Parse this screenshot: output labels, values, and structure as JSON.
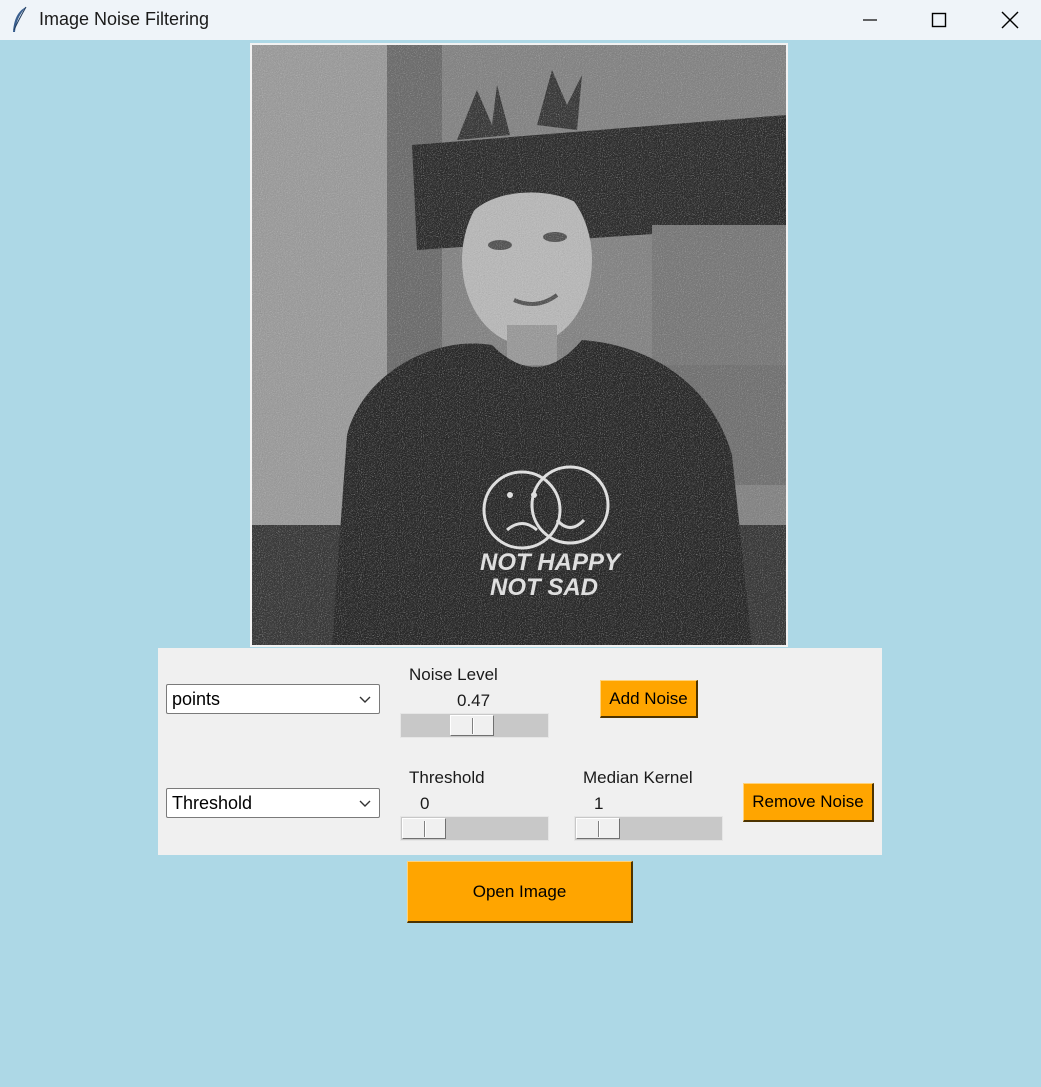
{
  "window": {
    "title": "Image Noise Filtering",
    "icon": "feather-icon",
    "controls": [
      "minimize-icon",
      "maximize-icon",
      "close-icon"
    ]
  },
  "noise_controls": {
    "noise_type": {
      "selected": "points"
    },
    "noise_level": {
      "label": "Noise Level",
      "value": "0.47"
    },
    "add_button": "Add Noise"
  },
  "filter_controls": {
    "filter_type": {
      "selected": "Threshold"
    },
    "threshold": {
      "label": "Threshold",
      "value": "0"
    },
    "median_kernel": {
      "label": "Median Kernel",
      "value": "1"
    },
    "remove_button": "Remove Noise"
  },
  "open_button": "Open Image",
  "colors": {
    "background": "#add8e6",
    "panel": "#f0f0f0",
    "button": "#ffa500"
  }
}
